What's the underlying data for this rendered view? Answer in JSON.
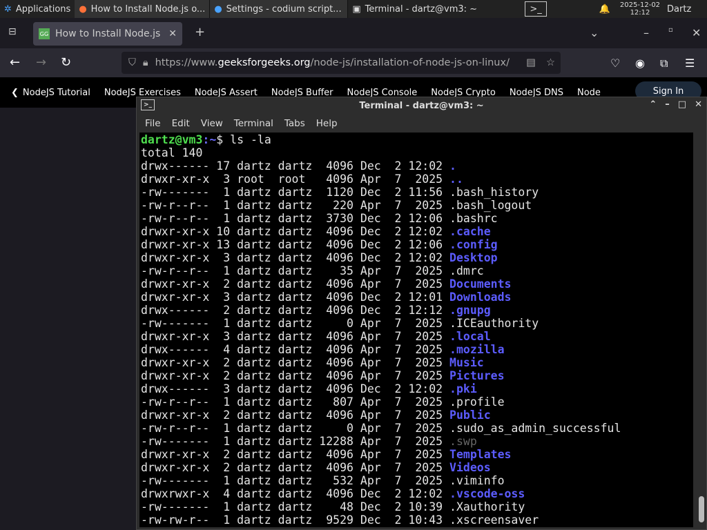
{
  "taskbar": {
    "apps": "Applications",
    "windows": [
      "How to Install Node.js o...",
      "Settings - codium script...",
      "Terminal - dartz@vm3: ~"
    ],
    "date": "2025-12-02",
    "time": "12:12",
    "user": "Dartz"
  },
  "browser": {
    "tab_title": "How to Install Node.js on",
    "url_prefix": "https://www.",
    "url_domain": "geeksforgeeks.org",
    "url_path": "/node-js/installation-of-node-js-on-linux/",
    "bookmarks": [
      "NodeJS Tutorial",
      "NodeJS Exercises",
      "NodeJS Assert",
      "NodeJS Buffer",
      "NodeJS Console",
      "NodeJS Crypto",
      "NodeJS DNS",
      "Node"
    ],
    "signin": "Sign In"
  },
  "terminal": {
    "title": "Terminal - dartz@vm3: ~",
    "menu": [
      "File",
      "Edit",
      "View",
      "Terminal",
      "Tabs",
      "Help"
    ],
    "prompt_user": "dartz@vm3",
    "prompt_path": ":~",
    "prompt_cmd": "$ ls -la",
    "total": "total 140",
    "rows": [
      {
        "meta": "drwx------ 17 dartz dartz  4096 Dec  2 12:02 ",
        "name": ".",
        "kind": "dir"
      },
      {
        "meta": "drwxr-xr-x  3 root  root   4096 Apr  7  2025 ",
        "name": "..",
        "kind": "dir"
      },
      {
        "meta": "-rw-------  1 dartz dartz  1120 Dec  2 11:56 ",
        "name": ".bash_history",
        "kind": "file"
      },
      {
        "meta": "-rw-r--r--  1 dartz dartz   220 Apr  7  2025 ",
        "name": ".bash_logout",
        "kind": "file"
      },
      {
        "meta": "-rw-r--r--  1 dartz dartz  3730 Dec  2 12:06 ",
        "name": ".bashrc",
        "kind": "file"
      },
      {
        "meta": "drwxr-xr-x 10 dartz dartz  4096 Dec  2 12:02 ",
        "name": ".cache",
        "kind": "dir"
      },
      {
        "meta": "drwxr-xr-x 13 dartz dartz  4096 Dec  2 12:06 ",
        "name": ".config",
        "kind": "dir"
      },
      {
        "meta": "drwxr-xr-x  3 dartz dartz  4096 Dec  2 12:02 ",
        "name": "Desktop",
        "kind": "dir"
      },
      {
        "meta": "-rw-r--r--  1 dartz dartz    35 Apr  7  2025 ",
        "name": ".dmrc",
        "kind": "file"
      },
      {
        "meta": "drwxr-xr-x  2 dartz dartz  4096 Apr  7  2025 ",
        "name": "Documents",
        "kind": "dir"
      },
      {
        "meta": "drwxr-xr-x  3 dartz dartz  4096 Dec  2 12:01 ",
        "name": "Downloads",
        "kind": "dir"
      },
      {
        "meta": "drwx------  2 dartz dartz  4096 Dec  2 12:12 ",
        "name": ".gnupg",
        "kind": "dir"
      },
      {
        "meta": "-rw-------  1 dartz dartz     0 Apr  7  2025 ",
        "name": ".ICEauthority",
        "kind": "file"
      },
      {
        "meta": "drwxr-xr-x  3 dartz dartz  4096 Apr  7  2025 ",
        "name": ".local",
        "kind": "dir"
      },
      {
        "meta": "drwx------  4 dartz dartz  4096 Apr  7  2025 ",
        "name": ".mozilla",
        "kind": "dir"
      },
      {
        "meta": "drwxr-xr-x  2 dartz dartz  4096 Apr  7  2025 ",
        "name": "Music",
        "kind": "dir"
      },
      {
        "meta": "drwxr-xr-x  2 dartz dartz  4096 Apr  7  2025 ",
        "name": "Pictures",
        "kind": "dir"
      },
      {
        "meta": "drwx------  3 dartz dartz  4096 Dec  2 12:02 ",
        "name": ".pki",
        "kind": "dir"
      },
      {
        "meta": "-rw-r--r--  1 dartz dartz   807 Apr  7  2025 ",
        "name": ".profile",
        "kind": "file"
      },
      {
        "meta": "drwxr-xr-x  2 dartz dartz  4096 Apr  7  2025 ",
        "name": "Public",
        "kind": "dir"
      },
      {
        "meta": "-rw-r--r--  1 dartz dartz     0 Apr  7  2025 ",
        "name": ".sudo_as_admin_successful",
        "kind": "file"
      },
      {
        "meta": "-rw-------  1 dartz dartz 12288 Apr  7  2025 ",
        "name": ".swp",
        "kind": "swp"
      },
      {
        "meta": "drwxr-xr-x  2 dartz dartz  4096 Apr  7  2025 ",
        "name": "Templates",
        "kind": "dir"
      },
      {
        "meta": "drwxr-xr-x  2 dartz dartz  4096 Apr  7  2025 ",
        "name": "Videos",
        "kind": "dir"
      },
      {
        "meta": "-rw-------  1 dartz dartz   532 Apr  7  2025 ",
        "name": ".viminfo",
        "kind": "file"
      },
      {
        "meta": "drwxrwxr-x  4 dartz dartz  4096 Dec  2 12:02 ",
        "name": ".vscode-oss",
        "kind": "dir"
      },
      {
        "meta": "-rw-------  1 dartz dartz    48 Dec  2 10:39 ",
        "name": ".Xauthority",
        "kind": "file"
      },
      {
        "meta": "-rw-rw-r--  1 dartz dartz  9529 Dec  2 10:43 ",
        "name": ".xscreensaver",
        "kind": "file"
      }
    ]
  }
}
